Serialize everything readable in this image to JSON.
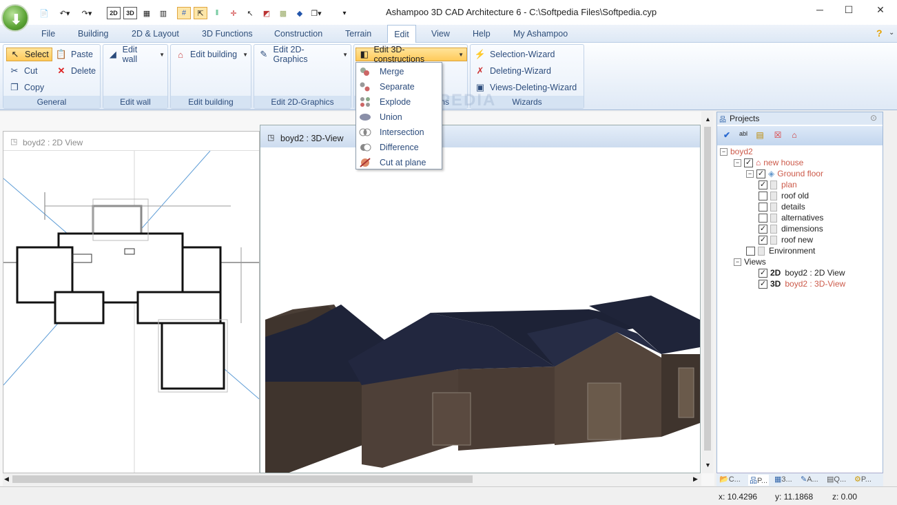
{
  "window": {
    "title": "Ashampoo 3D CAD Architecture 6 - C:\\Softpedia Files\\Softpedia.cyp",
    "minimize": "─",
    "maximize": "☐",
    "close": "✕"
  },
  "quick_access": {
    "view2d": "2D",
    "view3d": "3D",
    "overflow": "▾"
  },
  "menu": {
    "file": "File",
    "building": "Building",
    "layout": "2D & Layout",
    "functions3d": "3D Functions",
    "construction": "Construction",
    "terrain": "Terrain",
    "edit": "Edit",
    "view": "View",
    "help": "Help",
    "my_ashampoo": "My Ashampoo",
    "help_icon": "?",
    "collapse": "⌄"
  },
  "ribbon": {
    "general": {
      "label": "General",
      "select": "Select",
      "paste": "Paste",
      "cut": "Cut",
      "delete": "Delete",
      "copy": "Copy"
    },
    "edit_wall": {
      "label": "Edit wall",
      "button": "Edit wall"
    },
    "edit_building": {
      "label": "Edit building",
      "button": "Edit building"
    },
    "edit_2d": {
      "label": "Edit 2D-Graphics",
      "button": "Edit 2D-Graphics"
    },
    "edit_3d": {
      "label_suffix": "ns",
      "button": "Edit 3D-constructions"
    },
    "wizards": {
      "label": "Wizards",
      "selection": "Selection-Wizard",
      "deleting": "Deleting-Wizard",
      "views_deleting": "Views-Deleting-Wizard"
    }
  },
  "watermark": "SOFTPEDIA",
  "dropdown": {
    "items": [
      {
        "label": "Merge",
        "icon": "merge-icon"
      },
      {
        "label": "Separate",
        "icon": "separate-icon"
      },
      {
        "label": "Explode",
        "icon": "explode-icon"
      },
      {
        "label": "Union",
        "icon": "union-icon"
      },
      {
        "label": "Intersection",
        "icon": "intersection-icon"
      },
      {
        "label": "Difference",
        "icon": "difference-icon"
      },
      {
        "label": "Cut at plane",
        "icon": "cut-plane-icon"
      }
    ]
  },
  "views": {
    "view2d_title": "boyd2 : 2D View",
    "view3d_title": "boyd2 : 3D-View"
  },
  "projects": {
    "title": "Projects",
    "tree": {
      "root": "boyd2",
      "house": "new house",
      "floor": "Ground floor",
      "layers": [
        {
          "label": "plan",
          "checked": true,
          "red": true
        },
        {
          "label": "roof old",
          "checked": false,
          "red": false
        },
        {
          "label": "details",
          "checked": false,
          "red": false
        },
        {
          "label": "alternatives",
          "checked": false,
          "red": false
        },
        {
          "label": "dimensions",
          "checked": true,
          "red": false
        },
        {
          "label": "roof new",
          "checked": true,
          "red": false
        }
      ],
      "environment": "Environment",
      "views_node": "Views",
      "view_2d": {
        "prefix": "2D",
        "label": "boyd2 : 2D View"
      },
      "view_3d": {
        "prefix": "3D",
        "label": "boyd2 : 3D-View"
      }
    },
    "tabs": [
      "C...",
      "P...",
      "3...",
      "A...",
      "Q...",
      "P..."
    ]
  },
  "status": {
    "x": "x: 10.4296",
    "y": "y: 11.1868",
    "z": "z: 0.00"
  }
}
